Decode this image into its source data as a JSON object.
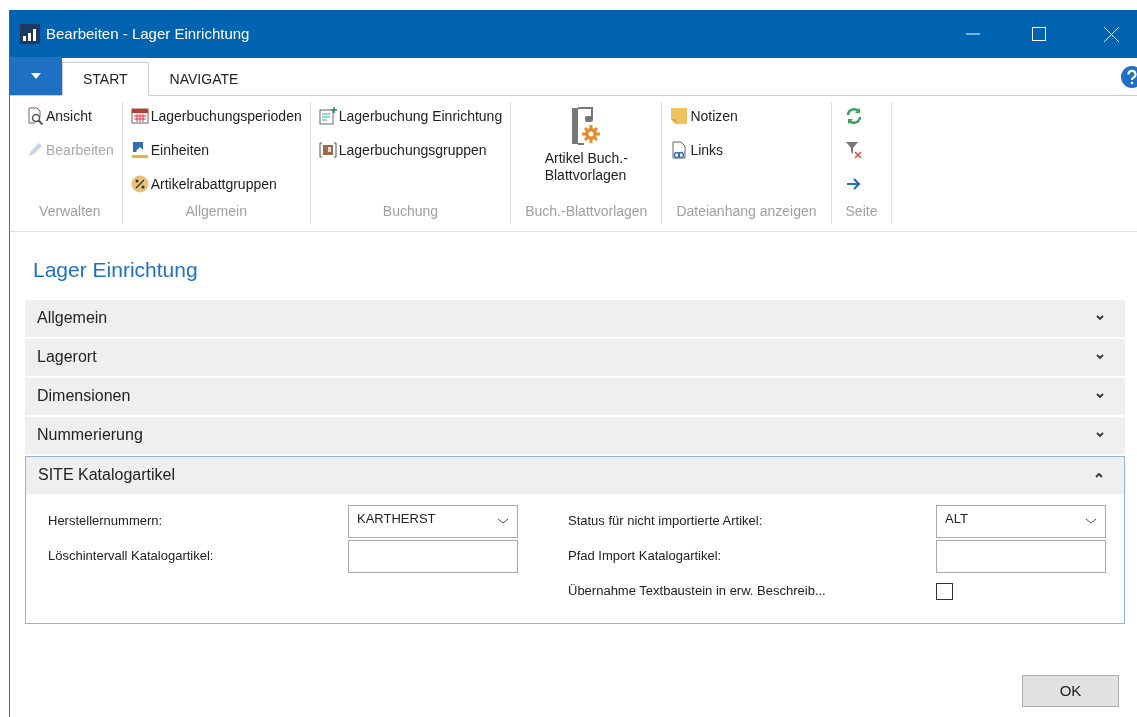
{
  "window": {
    "title": "Bearbeiten - Lager Einrichtung"
  },
  "tabs": [
    {
      "label": "START",
      "selected": true
    },
    {
      "label": "NAVIGATE",
      "selected": false
    }
  ],
  "ribbon": {
    "groups": [
      {
        "label": "Verwalten",
        "items": [
          {
            "kind": "small",
            "label": "Ansicht",
            "disabled": false
          },
          {
            "kind": "small",
            "label": "Bearbeiten",
            "disabled": true
          }
        ]
      },
      {
        "label": "Allgemein",
        "items": [
          {
            "kind": "small",
            "label": "Lagerbuchungsperioden",
            "disabled": false
          },
          {
            "kind": "small",
            "label": "Einheiten",
            "disabled": false
          },
          {
            "kind": "small",
            "label": "Artikelrabattgruppen",
            "disabled": false
          }
        ]
      },
      {
        "label": "Buchung",
        "items": [
          {
            "kind": "small",
            "label": "Lagerbuchung Einrichtung",
            "disabled": false
          },
          {
            "kind": "small",
            "label": "Lagerbuchungsgruppen",
            "disabled": false
          }
        ]
      },
      {
        "label": "Buch.-Blattvorlagen",
        "items": [
          {
            "kind": "large",
            "label": "Artikel Buch.-\nBlattvorlagen",
            "disabled": false
          }
        ]
      },
      {
        "label": "Dateianhang anzeigen",
        "items": [
          {
            "kind": "small",
            "label": "Notizen",
            "disabled": false
          },
          {
            "kind": "small",
            "label": "Links",
            "disabled": false
          }
        ]
      },
      {
        "label": "Seite",
        "items": [
          {
            "kind": "icon",
            "disabled": false
          },
          {
            "kind": "icon",
            "disabled": false
          },
          {
            "kind": "icon",
            "disabled": false
          }
        ]
      }
    ]
  },
  "page": {
    "title": "Lager Einrichtung"
  },
  "sections": [
    {
      "title": "Allgemein",
      "expanded": false
    },
    {
      "title": "Lagerort",
      "expanded": false
    },
    {
      "title": "Dimensionen",
      "expanded": false
    },
    {
      "title": "Nummerierung",
      "expanded": false
    },
    {
      "title": "SITE Katalogartikel",
      "expanded": true,
      "columns": [
        [
          {
            "kind": "dropdown",
            "label": "Herstellernummern:",
            "value": "KARTHERST"
          },
          {
            "kind": "text",
            "label": "Löschintervall Katalogartikel:"
          }
        ],
        [
          {
            "kind": "dropdown",
            "label": "Status für nicht importierte Artikel:",
            "value": "ALT"
          },
          {
            "kind": "text",
            "label": "Pfad Import Katalogartikel:"
          },
          {
            "kind": "checkbox",
            "label": "Übernahme Textbaustein in erw. Beschreib...",
            "checked": false
          }
        ]
      ]
    }
  ],
  "buttons": [
    {
      "label": "OK"
    }
  ]
}
